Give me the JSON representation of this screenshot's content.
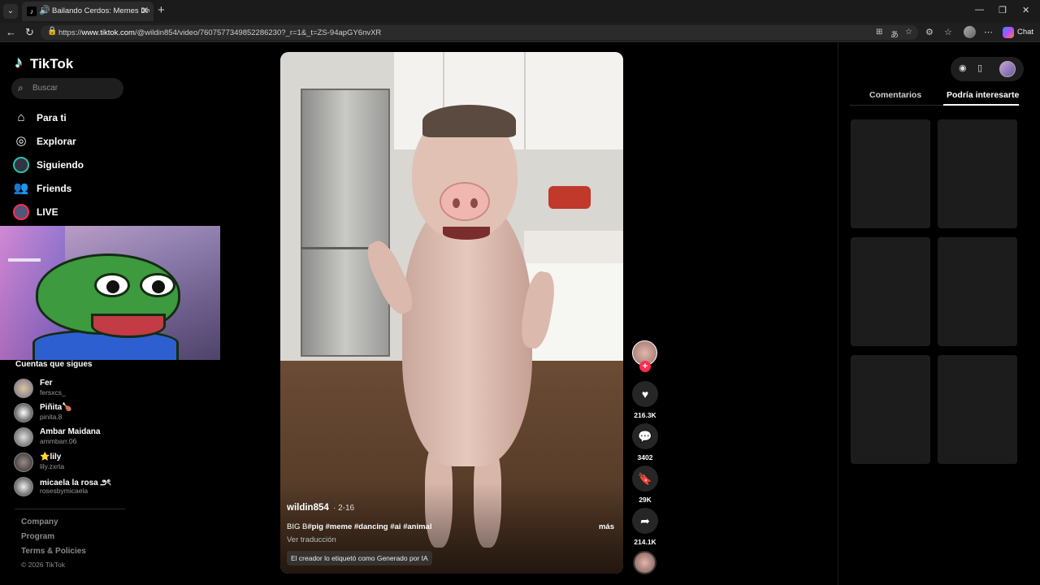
{
  "browser": {
    "tab_title": "Bailando Cerdos: Memes Divertidos",
    "url_prefix": "https://",
    "url_host": "www.tiktok.com",
    "url_path": "/@wildin854/video/7607577349852286230?_r=1&_t=ZS-94apGY6nvXR",
    "copilot_label": "Chat"
  },
  "sidebar": {
    "logo_text": "TikTok",
    "search_placeholder": "Buscar",
    "nav": [
      {
        "label": "Para ti",
        "icon": "home-icon"
      },
      {
        "label": "Explorar",
        "icon": "compass-icon"
      },
      {
        "label": "Siguiendo",
        "icon": "following-avatar-icon"
      },
      {
        "label": "Friends",
        "icon": "friends-icon"
      },
      {
        "label": "LIVE",
        "icon": "live-avatar-icon"
      }
    ],
    "following_heading": "Cuentas que sigues",
    "accounts": [
      {
        "name": "Fer",
        "handle": "fersxcs_"
      },
      {
        "name": "Piñita🍗",
        "handle": "pinita.8"
      },
      {
        "name": "Ambar Maidana",
        "handle": "ammbarr.06"
      },
      {
        "name": "⭐lily",
        "handle": "lily.zxrta"
      },
      {
        "name": "micaela la rosa ౨ৎ",
        "handle": "rosesbymicaela"
      }
    ],
    "footer": {
      "company": "Company",
      "program": "Program",
      "terms": "Terms & Policies",
      "copyright": "© 2026 TikTok"
    }
  },
  "video": {
    "username": "wildin854",
    "date": "· 2-16",
    "desc_prefix": "BIG B",
    "hashtags": "#pig #meme #dancing #ai #animal",
    "more": "más",
    "translate": "Ver traducción",
    "ai_label": "El creador lo etiquetó como Generado por IA"
  },
  "actions": {
    "likes": "216.3K",
    "comments": "3402",
    "saves": "29K",
    "shares": "214.1K"
  },
  "right_panel": {
    "tab_comments": "Comentarios",
    "tab_recommended": "Podría interesarte",
    "active_tab": "Podría interesarte"
  }
}
